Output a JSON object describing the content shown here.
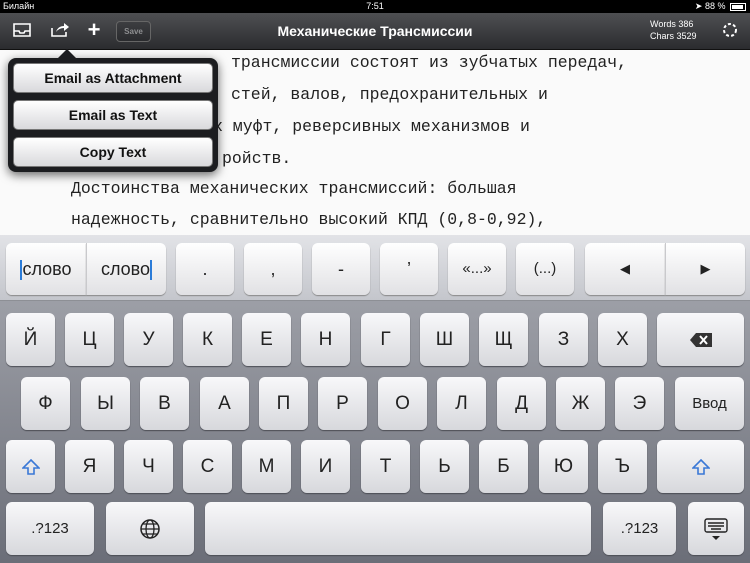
{
  "status_bar": {
    "carrier": "Билайн",
    "time": "7:51",
    "battery": "88 %"
  },
  "toolbar": {
    "save_label": "Save",
    "title": "Механические Трансмиссии",
    "words": "Words 386",
    "chars": "Chars 3529"
  },
  "document": {
    "lines": [
      "Механические трансмиссии состоят из зубчатых передач,",
      "цепей, муфт, частей, валов, предохранительных и",
      "фрикционных муфт, реверсивных механизмов и",
      "других устройств.",
      "Достоинства механических трансмиссий: большая",
      "надежность, сравнительно высокий КПД (0,8-0,92),"
    ],
    "visible_fragments": [
      "трансмиссии состоят из зубчатых передач,",
      "стей, валов, предохранительных и",
      "х муфт, реверсивных механизмов и",
      "ройств."
    ]
  },
  "popover": {
    "items": [
      "Email as Attachment",
      "Email as Text",
      "Copy Text"
    ]
  },
  "keyboard": {
    "suggest": {
      "word_left": "слово",
      "word_right": "слово",
      "period": ".",
      "comma": ",",
      "dash": "-",
      "apostrophe": "’",
      "quotes": "«...»",
      "parens": "(...)",
      "left": "◀",
      "right": "▶"
    },
    "row1": [
      "Й",
      "Ц",
      "У",
      "К",
      "Е",
      "Н",
      "Г",
      "Ш",
      "Щ",
      "З",
      "Х"
    ],
    "row2": [
      "Ф",
      "Ы",
      "В",
      "А",
      "П",
      "Р",
      "О",
      "Л",
      "Д",
      "Ж",
      "Э"
    ],
    "row3": [
      "Я",
      "Ч",
      "С",
      "М",
      "И",
      "Т",
      "Ь",
      "Б",
      "Ю",
      "Ъ"
    ],
    "enter": "Ввод",
    "numbers": ".?123",
    "numbers_right": ".?123"
  }
}
